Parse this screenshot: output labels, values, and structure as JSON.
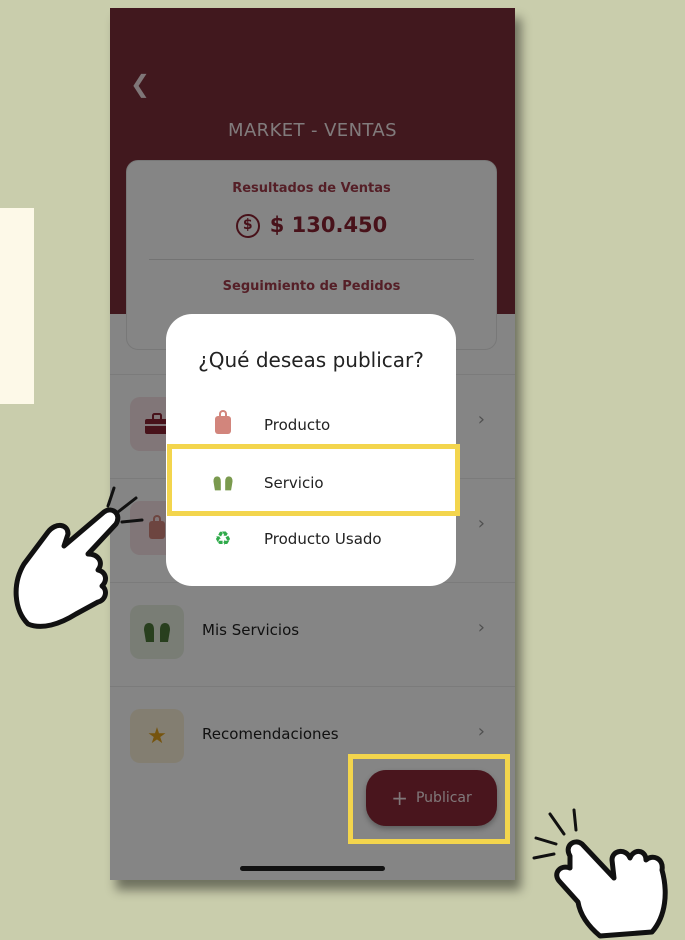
{
  "app": {
    "back_icon": "chevron-left-icon",
    "title": "MARKET - VENTAS"
  },
  "stats": {
    "sales_label": "Resultados de Ventas",
    "sales_amount": "$ 130.450",
    "orders_label": "Seguimiento de Pedidos"
  },
  "menu": {
    "items": [
      {
        "label": "",
        "icon": "briefcase-icon"
      },
      {
        "label": "",
        "icon": "shopping-bag-icon"
      },
      {
        "label": "Mis Servicios",
        "icon": "gloves-icon"
      },
      {
        "label": "Recomendaciones",
        "icon": "star-icon"
      }
    ]
  },
  "publish_button": {
    "label": "Publicar",
    "icon": "plus-icon"
  },
  "modal": {
    "title": "¿Qué deseas publicar?",
    "options": [
      {
        "label": "Producto",
        "icon": "shopping-bag-icon"
      },
      {
        "label": "Servicio",
        "icon": "gloves-icon"
      },
      {
        "label": "Producto Usado",
        "icon": "recycle-icon"
      }
    ]
  },
  "colors": {
    "background": "#c9cdac",
    "brand": "#7e2f3a",
    "highlight": "#f3d54d"
  }
}
